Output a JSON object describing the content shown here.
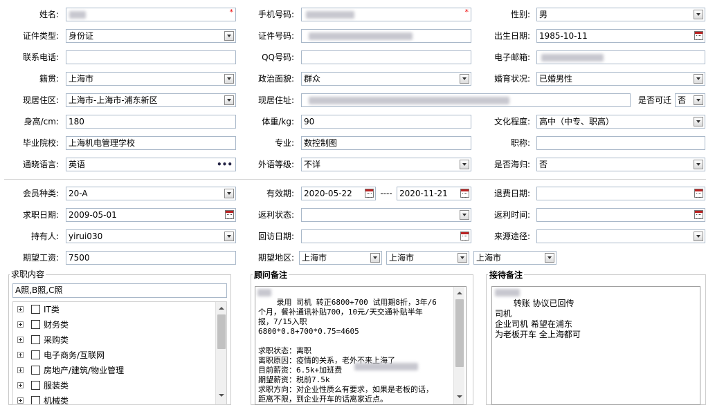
{
  "personal": {
    "name_label": "姓名:",
    "mobile_label": "手机号码:",
    "gender_label": "性别:",
    "gender_value": "男",
    "id_type_label": "证件类型:",
    "id_type_value": "身份证",
    "id_number_label": "证件号码:",
    "birth_label": "出生日期:",
    "birth_value": "1985-10-11",
    "phone_label": "联系电话:",
    "qq_label": "QQ号码:",
    "email_label": "电子邮箱:",
    "native_label": "籍贯:",
    "native_value": "上海市",
    "political_label": "政治面貌:",
    "political_value": "群众",
    "marital_label": "婚育状况:",
    "marital_value": "已婚男性",
    "residence_label": "现居住区:",
    "residence_value": "上海市-上海市-浦东新区",
    "address_label": "现居住址:",
    "relocate_label": "是否可迁",
    "relocate_value": "否",
    "height_label": "身高/cm:",
    "height_value": "180",
    "weight_label": "体重/kg:",
    "weight_value": "90",
    "education_label": "文化程度:",
    "education_value": "高中（中专、职高）",
    "school_label": "毕业院校:",
    "school_value": "上海机电管理学校",
    "major_label": "专业:",
    "major_value": "数控制图",
    "title_label": "职称:",
    "language_label": "通晓语言:",
    "language_value": "英语",
    "language_more": "•••",
    "foreign_level_label": "外语等级:",
    "foreign_level_value": "不详",
    "overseas_label": "是否海归:",
    "overseas_value": "否"
  },
  "membership": {
    "member_type_label": "会员种类:",
    "member_type_value": "20-A",
    "valid_label": "有效期:",
    "valid_from": "2020-05-22",
    "valid_sep": "----",
    "valid_to": "2020-11-21",
    "refund_date_label": "退费日期:",
    "job_date_label": "求职日期:",
    "job_date_value": "2009-05-01",
    "rebate_status_label": "返利状态:",
    "rebate_time_label": "返利时间:",
    "holder_label": "持有人:",
    "holder_value": "yirui030",
    "visit_date_label": "回访日期:",
    "source_label": "来源途径:",
    "salary_label": "期望工资:",
    "salary_value": "7500",
    "region_label": "期望地区:",
    "region_1": "上海市",
    "region_2": "上海市",
    "region_3": "上海市"
  },
  "job_content": {
    "title": "求职内容",
    "summary": "A照,B照,C照",
    "tree": [
      "IT类",
      "财务类",
      "采购类",
      "电子商务/互联网",
      "房地产/建筑/物业管理",
      "服装类",
      "机械类"
    ]
  },
  "advisor_notes": {
    "title": "顾问备注",
    "text": "  录用 司机 转正6800+700 试用期8折，3年/6\n个月，餐补通讯补贴700，10元/天交通补贴半年\n报，7/15入职\n6800*0.8+700*0.75=4605\n\n求职状态：离职\n离职原因：疫情的关系，老外不来上海了\n目前薪资：6.5k+加班费\n期望薪资：税前7.5k\n求职方向：对企业性质么有要求，如果是老板的话，\n距离不限，到企业开车的话离家近点。"
  },
  "reception_notes": {
    "title": "接待备注",
    "text": "     转账 协议已回传\n司机\n企业司机 希望在浦东\n为老板开车 全上海都可"
  },
  "colors": {
    "required": "#ee0000",
    "border": "#a9b8c9"
  }
}
